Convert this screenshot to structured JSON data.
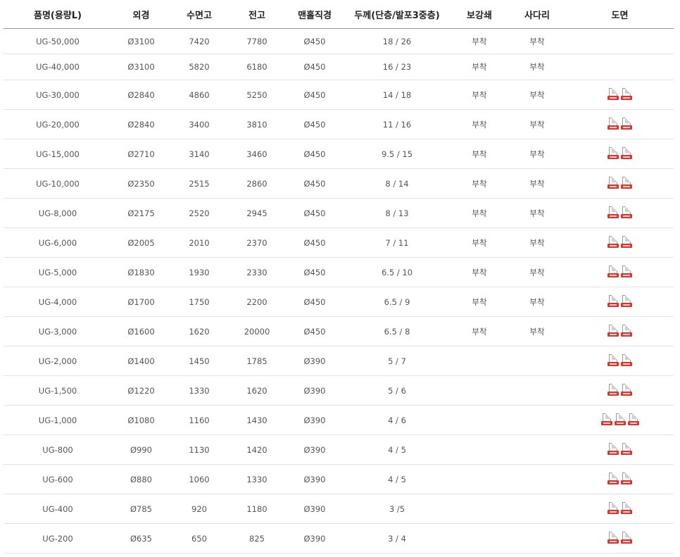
{
  "table": {
    "headers": [
      "품명(용량L)",
      "외경",
      "수면고",
      "전고",
      "맨홀직경",
      "두께(단층/발포3중층)",
      "보강쇄",
      "사다리",
      "도면"
    ],
    "rows": [
      {
        "name": "UG-50,000",
        "outer": "Ø3100",
        "water": "7420",
        "total": "7780",
        "manhole": "Ø450",
        "thickness": "18 / 26",
        "reinforce": "부착",
        "ladder": "부착",
        "drawings": 0
      },
      {
        "name": "UG-40,000",
        "outer": "Ø3100",
        "water": "5820",
        "total": "6180",
        "manhole": "Ø450",
        "thickness": "16 / 23",
        "reinforce": "부착",
        "ladder": "부착",
        "drawings": 0
      },
      {
        "name": "UG-30,000",
        "outer": "Ø2840",
        "water": "4860",
        "total": "5250",
        "manhole": "Ø450",
        "thickness": "14 / 18",
        "reinforce": "부착",
        "ladder": "부착",
        "drawings": 2
      },
      {
        "name": "UG-20,000",
        "outer": "Ø2840",
        "water": "3400",
        "total": "3810",
        "manhole": "Ø450",
        "thickness": "11 / 16",
        "reinforce": "부착",
        "ladder": "부착",
        "drawings": 2
      },
      {
        "name": "UG-15,000",
        "outer": "Ø2710",
        "water": "3140",
        "total": "3460",
        "manhole": "Ø450",
        "thickness": "9.5 / 15",
        "reinforce": "부착",
        "ladder": "부착",
        "drawings": 2
      },
      {
        "name": "UG-10,000",
        "outer": "Ø2350",
        "water": "2515",
        "total": "2860",
        "manhole": "Ø450",
        "thickness": "8 / 14",
        "reinforce": "부착",
        "ladder": "부착",
        "drawings": 2
      },
      {
        "name": "UG-8,000",
        "outer": "Ø2175",
        "water": "2520",
        "total": "2945",
        "manhole": "Ø450",
        "thickness": "8 / 13",
        "reinforce": "부착",
        "ladder": "부착",
        "drawings": 2
      },
      {
        "name": "UG-6,000",
        "outer": "Ø2005",
        "water": "2010",
        "total": "2370",
        "manhole": "Ø450",
        "thickness": "7 / 11",
        "reinforce": "부착",
        "ladder": "부착",
        "drawings": 2
      },
      {
        "name": "UG-5,000",
        "outer": "Ø1830",
        "water": "1930",
        "total": "2330",
        "manhole": "Ø450",
        "thickness": "6.5 / 10",
        "reinforce": "부착",
        "ladder": "부착",
        "drawings": 2
      },
      {
        "name": "UG-4,000",
        "outer": "Ø1700",
        "water": "1750",
        "total": "2200",
        "manhole": "Ø450",
        "thickness": "6.5 / 9",
        "reinforce": "부착",
        "ladder": "부착",
        "drawings": 2
      },
      {
        "name": "UG-3,000",
        "outer": "Ø1600",
        "water": "1620",
        "total": "20000",
        "manhole": "Ø450",
        "thickness": "6.5 / 8",
        "reinforce": "부착",
        "ladder": "부착",
        "drawings": 2
      },
      {
        "name": "UG-2,000",
        "outer": "Ø1400",
        "water": "1450",
        "total": "1785",
        "manhole": "Ø390",
        "thickness": "5 / 7",
        "reinforce": "",
        "ladder": "",
        "drawings": 2
      },
      {
        "name": "UG-1,500",
        "outer": "Ø1220",
        "water": "1330",
        "total": "1620",
        "manhole": "Ø390",
        "thickness": "5 / 6",
        "reinforce": "",
        "ladder": "",
        "drawings": 2
      },
      {
        "name": "UG-1,000",
        "outer": "Ø1080",
        "water": "1160",
        "total": "1430",
        "manhole": "Ø390",
        "thickness": "4 / 6",
        "reinforce": "",
        "ladder": "",
        "drawings": 3
      },
      {
        "name": "UG-800",
        "outer": "Ø990",
        "water": "1130",
        "total": "1420",
        "manhole": "Ø390",
        "thickness": "4 / 5",
        "reinforce": "",
        "ladder": "",
        "drawings": 2
      },
      {
        "name": "UG-600",
        "outer": "Ø880",
        "water": "1060",
        "total": "1330",
        "manhole": "Ø390",
        "thickness": "4 / 5",
        "reinforce": "",
        "ladder": "",
        "drawings": 2
      },
      {
        "name": "UG-400",
        "outer": "Ø785",
        "water": "920",
        "total": "1180",
        "manhole": "Ø390",
        "thickness": "3 /5",
        "reinforce": "",
        "ladder": "",
        "drawings": 2
      },
      {
        "name": "UG-200",
        "outer": "Ø635",
        "water": "650",
        "total": "825",
        "manhole": "Ø390",
        "thickness": "3 / 4",
        "reinforce": "",
        "ladder": "",
        "drawings": 2
      }
    ]
  },
  "icons": {
    "drawing": "pdf-file-icon",
    "pdf_color": "#d8372f"
  }
}
